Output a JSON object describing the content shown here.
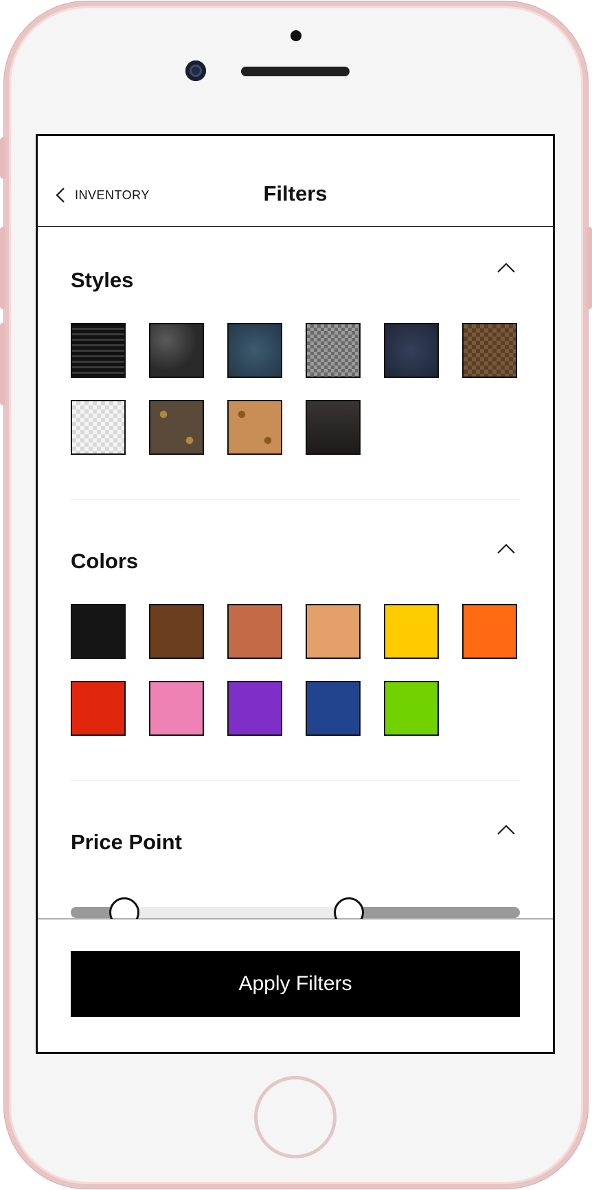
{
  "nav": {
    "back_label": "INVENTORY",
    "title": "Filters"
  },
  "styles": {
    "title": "Styles",
    "swatches": [
      {
        "name": "black-epi",
        "bg": "repeating-linear-gradient(180deg,#111 0 5px,#3a3a3a 5px 8px)"
      },
      {
        "name": "black-taurillon",
        "bg": "radial-gradient(circle at 30% 30%,#5a5a5a,#2a2a2a 60%)"
      },
      {
        "name": "blue-monogram-empreinte",
        "bg": "radial-gradient(circle,#3d5a70,#24384a)"
      },
      {
        "name": "grey-damier-graphite",
        "bg": "repeating-conic-gradient(#6a6a6a 0 25%,#9b9b9b 0 50%) 0 0/10px 10px"
      },
      {
        "name": "navy-monogram",
        "bg": "radial-gradient(circle,#34405a,#1f2638)"
      },
      {
        "name": "brown-damier-ebene",
        "bg": "repeating-conic-gradient(#5a3f28 0 25%,#7a5a3a 0 50%) 0 0/12px 12px"
      },
      {
        "name": "white-damier-azur",
        "bg": "repeating-conic-gradient(#d8d8d8 0 25%,#f4f4f4 0 50%) 0 0/12px 12px"
      },
      {
        "name": "brown-monogram",
        "bg": "radial-gradient(circle at 25% 25%,#b08a3a 0 6%,transparent 7%),radial-gradient(circle at 75% 75%,#b08a3a 0 6%,transparent 7%),#5a4a3a"
      },
      {
        "name": "tan-monogram",
        "bg": "radial-gradient(circle at 25% 25%,#8a5a1a 0 6%,transparent 7%),radial-gradient(circle at 75% 75%,#8a5a1a 0 6%,transparent 7%),#c98e55"
      },
      {
        "name": "dark-croc",
        "bg": "linear-gradient(180deg,#3a3434,#1e1a1a)"
      }
    ]
  },
  "colors": {
    "title": "Colors",
    "swatches": [
      "#151515",
      "#6b3e1e",
      "#c56a47",
      "#e3a068",
      "#ffcc00",
      "#ff6a13",
      "#e0260c",
      "#ee82b5",
      "#7d2fc8",
      "#22448f",
      "#72d100"
    ]
  },
  "price": {
    "title": "Price Point",
    "range_low_fraction": 0.12,
    "range_high_fraction": 0.62
  },
  "footer": {
    "apply_label": "Apply Filters"
  }
}
